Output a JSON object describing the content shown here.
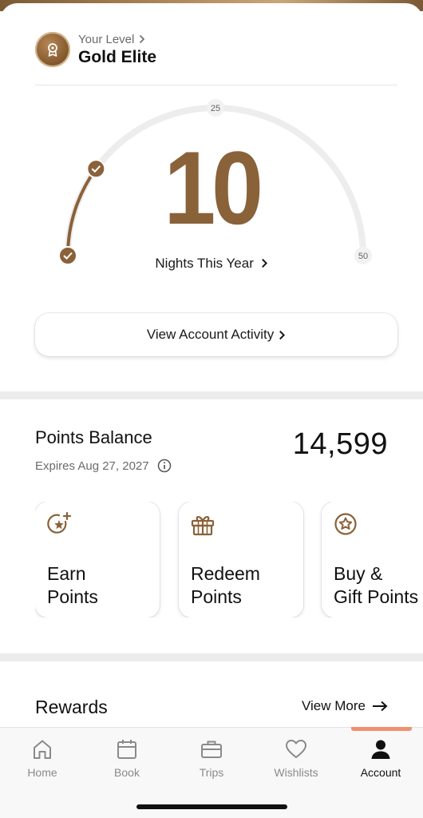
{
  "level": {
    "caption": "Your Level",
    "name": "Gold Elite"
  },
  "nights": {
    "count": "10",
    "label": "Nights This Year",
    "milestone_mid": "25",
    "milestone_max": "50",
    "progress_fraction": 0.2
  },
  "activity": {
    "label": "View Account Activity"
  },
  "points": {
    "title": "Points Balance",
    "expires": "Expires Aug 27, 2027",
    "balance": "14,599"
  },
  "tiles": [
    {
      "label": "Earn\nPoints",
      "icon": "star-plus-icon"
    },
    {
      "label": "Redeem\nPoints",
      "icon": "gift-icon"
    },
    {
      "label": "Buy &\nGift Points",
      "icon": "star-circle-icon"
    }
  ],
  "rewards": {
    "title": "Rewards",
    "view_more": "View More"
  },
  "tabs": [
    {
      "label": "Home",
      "icon": "home-icon"
    },
    {
      "label": "Book",
      "icon": "calendar-icon"
    },
    {
      "label": "Trips",
      "icon": "suitcase-icon"
    },
    {
      "label": "Wishlists",
      "icon": "heart-icon"
    },
    {
      "label": "Account",
      "icon": "person-icon"
    }
  ],
  "colors": {
    "accent": "#8a6239",
    "track": "#ededed",
    "active_tab": "#f09070"
  }
}
